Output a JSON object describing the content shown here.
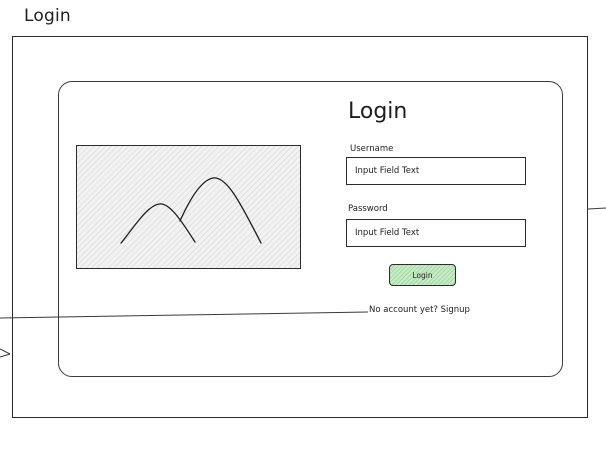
{
  "page": {
    "heading": "Login"
  },
  "login_form": {
    "title": "Login",
    "username": {
      "label": "Username",
      "placeholder": "Input Field Text"
    },
    "password": {
      "label": "Password",
      "placeholder": "Input Field Text"
    },
    "login_button_label": "Login",
    "signup_link_text": "No account yet? Signup"
  },
  "icons": {
    "image_placeholder": "mountain-image-icon"
  },
  "colors": {
    "stroke": "#1e1e1e",
    "button_fill": "#c8ecc8",
    "image_fill": "#f2f2f2"
  }
}
